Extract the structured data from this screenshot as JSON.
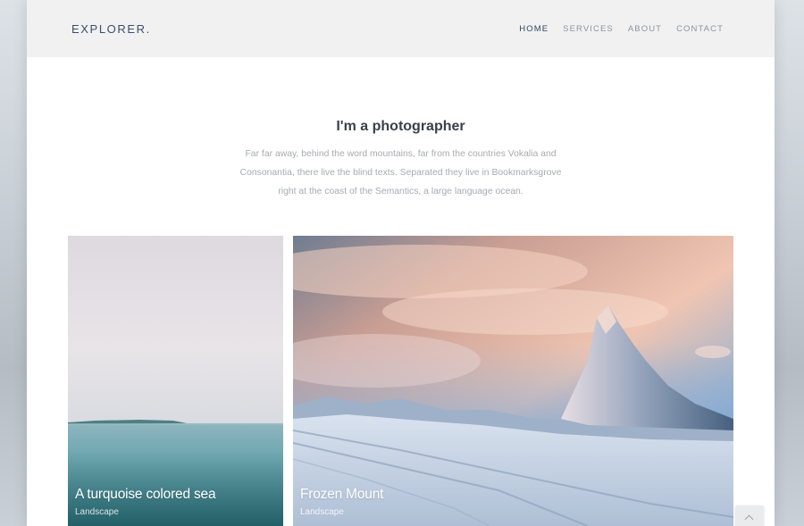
{
  "brand": {
    "logo": "EXPLORER."
  },
  "nav": {
    "items": [
      {
        "label": "HOME"
      },
      {
        "label": "SERVICES"
      },
      {
        "label": "ABOUT"
      },
      {
        "label": "CONTACT"
      }
    ]
  },
  "intro": {
    "title": "I'm a photographer",
    "text": "Far far away, behind the word mountains, far from the countries Vokalia and Consonantia, there live the blind texts. Separated they live in Bookmarksgrove right at the coast of the Semantics, a large language ocean."
  },
  "gallery": {
    "items": [
      {
        "title": "A turquoise colored sea",
        "category": "Landscape"
      },
      {
        "title": "Frozen Mount",
        "category": "Landscape"
      }
    ]
  },
  "colors": {
    "accent": "#2f4660",
    "text": "#39414b",
    "muted": "#a6abb1"
  },
  "icons": {
    "scroll_top": "chevron-up-icon"
  }
}
